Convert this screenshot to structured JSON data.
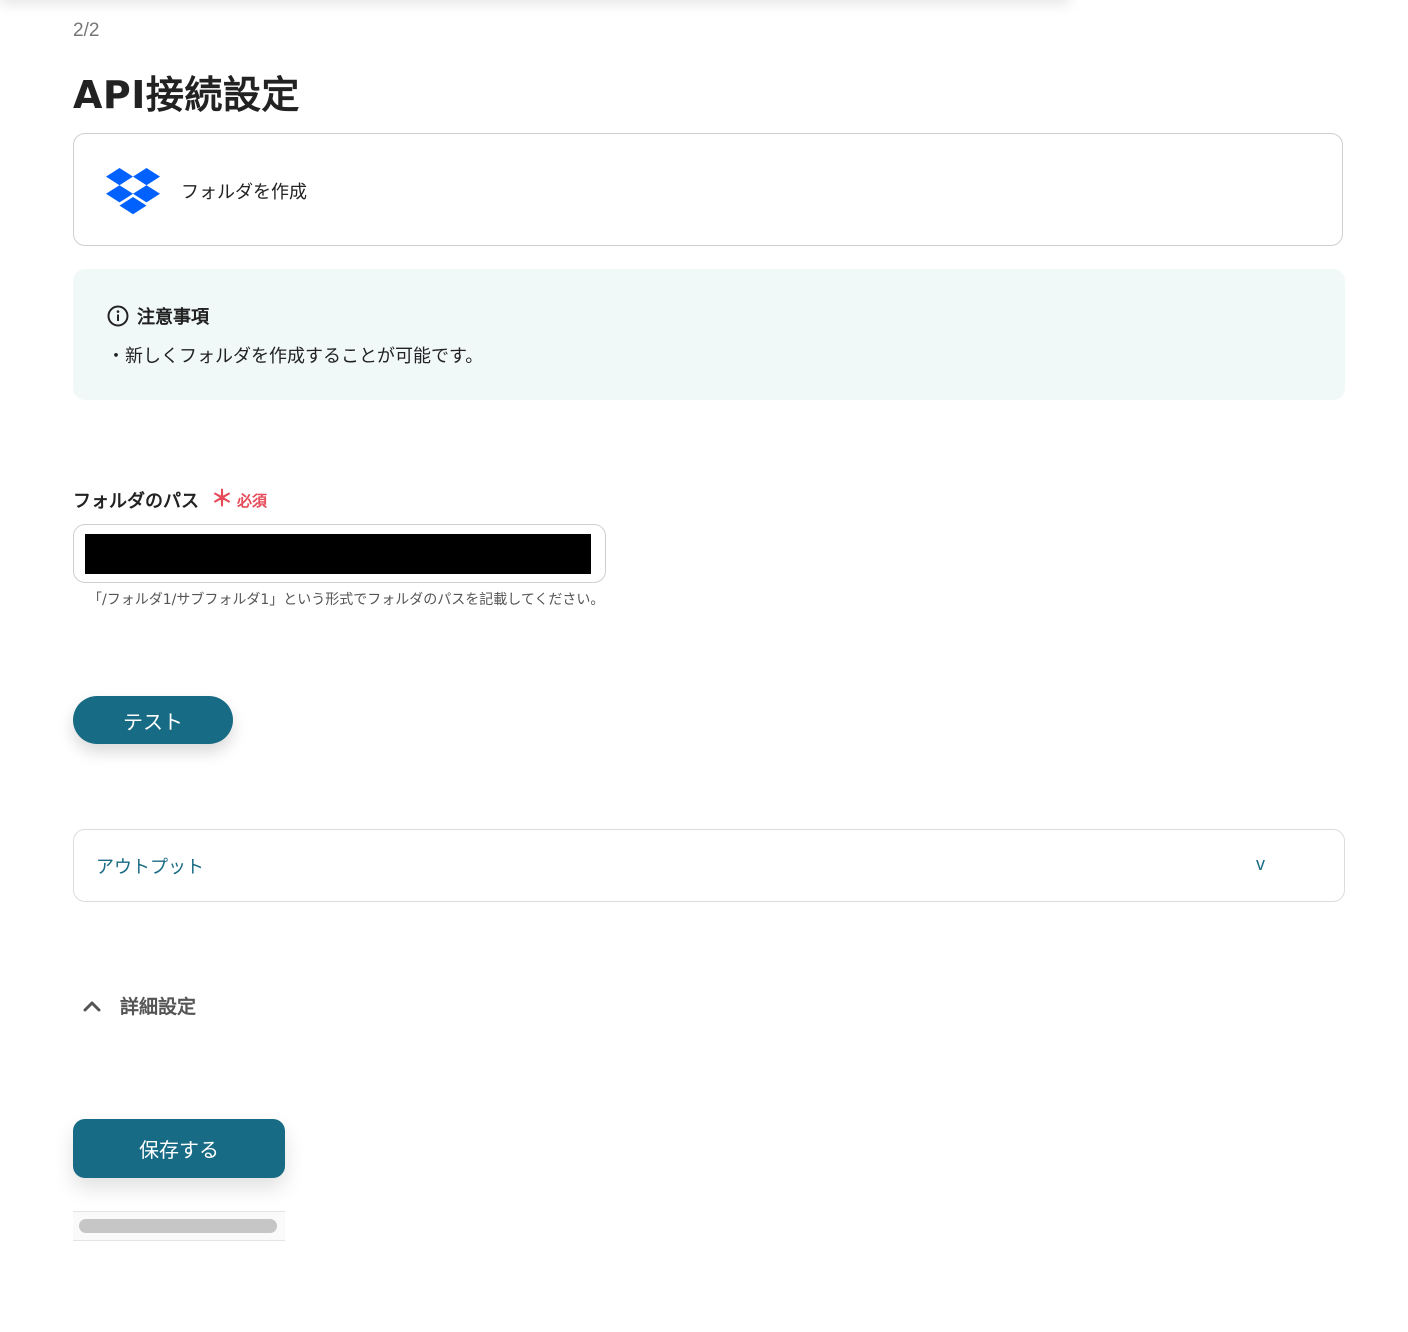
{
  "header": {
    "step": "2/2",
    "title": "API接続設定"
  },
  "action": {
    "app_icon": "dropbox-icon",
    "name": "フォルダを作成"
  },
  "notice": {
    "icon": "info-icon",
    "title": "注意事項",
    "body": "・新しくフォルダを作成することが可能です。",
    "background": "#f1f9f8"
  },
  "form": {
    "folder_path": {
      "label": "フォルダのパス",
      "required_mark": "＊",
      "required_text": "必須",
      "value": "",
      "help": "「/フォルダ1/サブフォルダ1」という形式でフォルダのパスを記載してください。"
    }
  },
  "buttons": {
    "test": "テスト",
    "save": "保存する"
  },
  "output": {
    "label": "アウトプット",
    "chevron": "v"
  },
  "advanced": {
    "label": "詳細設定",
    "icon": "chevron-up-icon"
  },
  "colors": {
    "primary": "#186b84",
    "required": "#e64b5a",
    "dropbox": "#0061fe"
  }
}
